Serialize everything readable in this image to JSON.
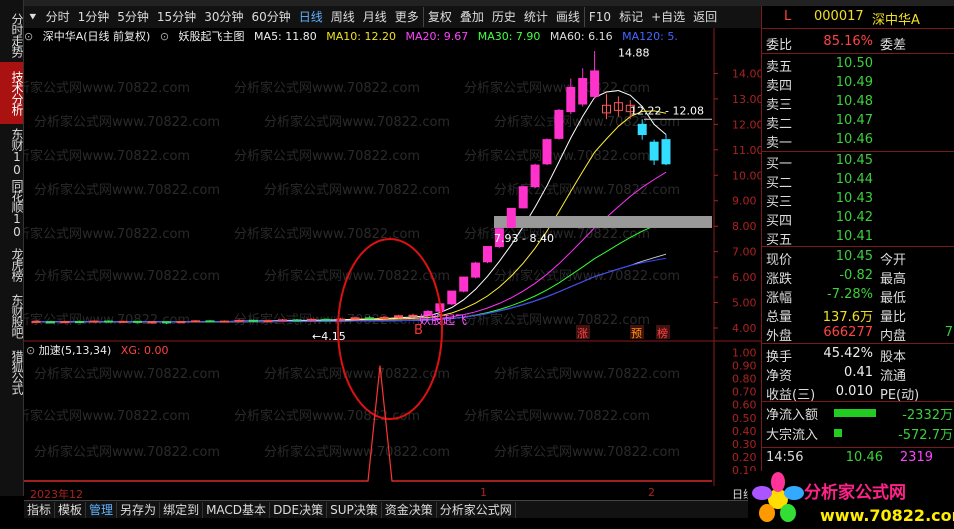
{
  "toolbar": {
    "items": [
      "分时",
      "1分钟",
      "5分钟",
      "15分钟",
      "30分钟",
      "60分钟",
      "日线",
      "周线",
      "月线",
      "更多",
      "复权",
      "叠加",
      "历史",
      "统计",
      "画线",
      "F10",
      "标记",
      "+自选",
      "返回"
    ],
    "active": "日线"
  },
  "left_tabs": [
    "分时走势",
    "技术分析",
    "东财10",
    "同花顺10",
    "龙虎榜",
    "东财股吧",
    "猎狐公式"
  ],
  "chart": {
    "header": {
      "title": "深中华A(日线 前复权)",
      "formula": "妖股起飞主图",
      "ma5": "MA5: 11.80",
      "ma10": "MA10: 12.20",
      "ma20": "MA20: 9.67",
      "ma30": "MA30: 7.90",
      "ma60": "MA60: 6.16",
      "ma120": "MA120: 5."
    },
    "annotations": {
      "high": "14.88",
      "range_top": "12.22 - 12.08",
      "range_box": "7.93 - 8.40",
      "low": "4.15",
      "signal": "妖股起飞",
      "buy_mark": "B",
      "tags": [
        "涨",
        "预",
        "榜"
      ]
    },
    "sub_header": {
      "name": "加速(5,13,34)",
      "value": "XG: 0.00"
    },
    "watermark": "分析家公式网www.70822.com",
    "dates": [
      "2023年12",
      "1",
      "2"
    ],
    "price_axis": [
      "14.00",
      "13.00",
      "12.00",
      "11.00",
      "10.00",
      "9.00",
      "8.00",
      "7.00",
      "6.00",
      "5.00",
      "4.00"
    ],
    "sub_axis": [
      "1.00",
      "0.90",
      "0.80",
      "0.70",
      "0.60",
      "0.50",
      "0.40",
      "0.30",
      "0.20",
      "0.10"
    ],
    "day_label": "日线",
    "chart_data": {
      "type": "candlestick",
      "candles": [
        {
          "o": 4.22,
          "c": 4.26,
          "h": 4.3,
          "l": 4.18
        },
        {
          "o": 4.24,
          "c": 4.22,
          "h": 4.28,
          "l": 4.18
        },
        {
          "o": 4.22,
          "c": 4.25,
          "h": 4.28,
          "l": 4.19
        },
        {
          "o": 4.25,
          "c": 4.23,
          "h": 4.29,
          "l": 4.19
        },
        {
          "o": 4.23,
          "c": 4.27,
          "h": 4.3,
          "l": 4.2
        },
        {
          "o": 4.27,
          "c": 4.24,
          "h": 4.3,
          "l": 4.2
        },
        {
          "o": 4.24,
          "c": 4.26,
          "h": 4.29,
          "l": 4.2
        },
        {
          "o": 4.26,
          "c": 4.22,
          "h": 4.28,
          "l": 4.18
        },
        {
          "o": 4.22,
          "c": 4.24,
          "h": 4.27,
          "l": 4.17
        },
        {
          "o": 4.24,
          "c": 4.21,
          "h": 4.26,
          "l": 4.15
        },
        {
          "o": 4.21,
          "c": 4.25,
          "h": 4.28,
          "l": 4.18
        },
        {
          "o": 4.25,
          "c": 4.28,
          "h": 4.31,
          "l": 4.22
        },
        {
          "o": 4.28,
          "c": 4.25,
          "h": 4.32,
          "l": 4.22
        },
        {
          "o": 4.25,
          "c": 4.27,
          "h": 4.3,
          "l": 4.22
        },
        {
          "o": 4.27,
          "c": 4.3,
          "h": 4.33,
          "l": 4.24
        },
        {
          "o": 4.3,
          "c": 4.26,
          "h": 4.33,
          "l": 4.23
        },
        {
          "o": 4.26,
          "c": 4.29,
          "h": 4.32,
          "l": 4.23
        },
        {
          "o": 4.29,
          "c": 4.32,
          "h": 4.36,
          "l": 4.26
        },
        {
          "o": 4.32,
          "c": 4.3,
          "h": 4.36,
          "l": 4.27
        },
        {
          "o": 4.3,
          "c": 4.34,
          "h": 4.38,
          "l": 4.27
        },
        {
          "o": 4.34,
          "c": 4.31,
          "h": 4.38,
          "l": 4.28
        },
        {
          "o": 4.31,
          "c": 4.35,
          "h": 4.4,
          "l": 4.28
        },
        {
          "o": 4.35,
          "c": 4.4,
          "h": 4.45,
          "l": 4.32
        },
        {
          "o": 4.4,
          "c": 4.37,
          "h": 4.46,
          "l": 4.33
        },
        {
          "o": 4.37,
          "c": 4.42,
          "h": 4.47,
          "l": 4.34
        },
        {
          "o": 4.42,
          "c": 4.48,
          "h": 4.52,
          "l": 4.38
        },
        {
          "o": 4.48,
          "c": 4.5,
          "h": 4.56,
          "l": 4.44
        },
        {
          "o": 4.5,
          "c": 4.65,
          "h": 4.7,
          "l": 4.46
        },
        {
          "o": 4.66,
          "c": 4.95,
          "h": 4.98,
          "l": 4.6
        },
        {
          "o": 4.95,
          "c": 5.45,
          "h": 5.45,
          "l": 4.9
        },
        {
          "o": 5.45,
          "c": 6.0,
          "h": 6.0,
          "l": 5.4
        },
        {
          "o": 6.0,
          "c": 6.55,
          "h": 6.6,
          "l": 5.95
        },
        {
          "o": 6.6,
          "c": 7.2,
          "h": 7.2,
          "l": 6.55
        },
        {
          "o": 7.2,
          "c": 7.9,
          "h": 7.95,
          "l": 7.15
        },
        {
          "o": 7.95,
          "c": 8.7,
          "h": 8.7,
          "l": 7.93
        },
        {
          "o": 8.72,
          "c": 9.55,
          "h": 9.6,
          "l": 8.7
        },
        {
          "o": 9.55,
          "c": 10.4,
          "h": 10.45,
          "l": 9.5
        },
        {
          "o": 10.45,
          "c": 11.4,
          "h": 11.45,
          "l": 10.4
        },
        {
          "o": 11.45,
          "c": 12.55,
          "h": 12.6,
          "l": 11.4
        },
        {
          "o": 12.5,
          "c": 13.45,
          "h": 13.8,
          "l": 12.4
        },
        {
          "o": 12.8,
          "c": 13.8,
          "h": 14.2,
          "l": 12.7
        },
        {
          "o": 13.1,
          "c": 14.1,
          "h": 14.88,
          "l": 13.0
        },
        {
          "o": 12.75,
          "c": 12.45,
          "h": 13.2,
          "l": 12.2
        },
        {
          "o": 12.55,
          "c": 12.85,
          "h": 13.1,
          "l": 12.3
        },
        {
          "o": 12.75,
          "c": 12.5,
          "h": 12.95,
          "l": 12.22
        },
        {
          "o": 12.0,
          "c": 11.6,
          "h": 12.2,
          "l": 11.4
        },
        {
          "o": 11.3,
          "c": 10.6,
          "h": 11.4,
          "l": 10.4
        },
        {
          "o": 11.4,
          "c": 10.45,
          "h": 11.6,
          "l": 10.4
        }
      ],
      "spike": {
        "x_index": 27,
        "value": 0.9
      }
    }
  },
  "quote": {
    "code": "000017",
    "name": "深中华A",
    "flag": "L",
    "weibi_label": "委比",
    "weibi_value": "85.16%",
    "weicha_label": "委差",
    "asks": [
      {
        "label": "卖五",
        "price": "10.50"
      },
      {
        "label": "卖四",
        "price": "10.49"
      },
      {
        "label": "卖三",
        "price": "10.48"
      },
      {
        "label": "卖二",
        "price": "10.47"
      },
      {
        "label": "卖一",
        "price": "10.46"
      }
    ],
    "bids": [
      {
        "label": "买一",
        "price": "10.45"
      },
      {
        "label": "买二",
        "price": "10.44"
      },
      {
        "label": "买三",
        "price": "10.43"
      },
      {
        "label": "买四",
        "price": "10.42"
      },
      {
        "label": "买五",
        "price": "10.41"
      }
    ],
    "stats": [
      {
        "label": "现价",
        "value": "10.45",
        "label2": "今开",
        "cls": "green"
      },
      {
        "label": "涨跌",
        "value": "-0.82",
        "label2": "最高",
        "cls": "green"
      },
      {
        "label": "涨幅",
        "value": "-7.28%",
        "label2": "最低",
        "cls": "green"
      },
      {
        "label": "总量",
        "value": "137.6万",
        "label2": "量比",
        "cls": "yellow"
      },
      {
        "label": "外盘",
        "value": "666277",
        "label2": "内盘",
        "cls": "red"
      }
    ],
    "stats2": [
      {
        "label": "换手",
        "value": "45.42%",
        "label2": "股本"
      },
      {
        "label": "净资",
        "value": "0.41",
        "label2": "流通"
      },
      {
        "label": "收益(三)",
        "value": "0.010",
        "label2": "PE(动)"
      }
    ],
    "neipan_partial": "7",
    "flow": [
      {
        "label": "净流入额",
        "value": "-2332万"
      },
      {
        "label": "大宗流入",
        "value": "-572.7万"
      }
    ],
    "tick": {
      "time": "14:56",
      "price": "10.46",
      "vol": "2319"
    }
  },
  "bottom_tabs": [
    "指标",
    "模板",
    "管理",
    "另存为",
    "绑定到",
    "MACD基本",
    "DDE决策",
    "SUP决策",
    "资金决策",
    "分析家公式网"
  ],
  "bottom_active": "管理",
  "logo": {
    "text": "分析家公式网",
    "url_text": "www.70822.com"
  }
}
